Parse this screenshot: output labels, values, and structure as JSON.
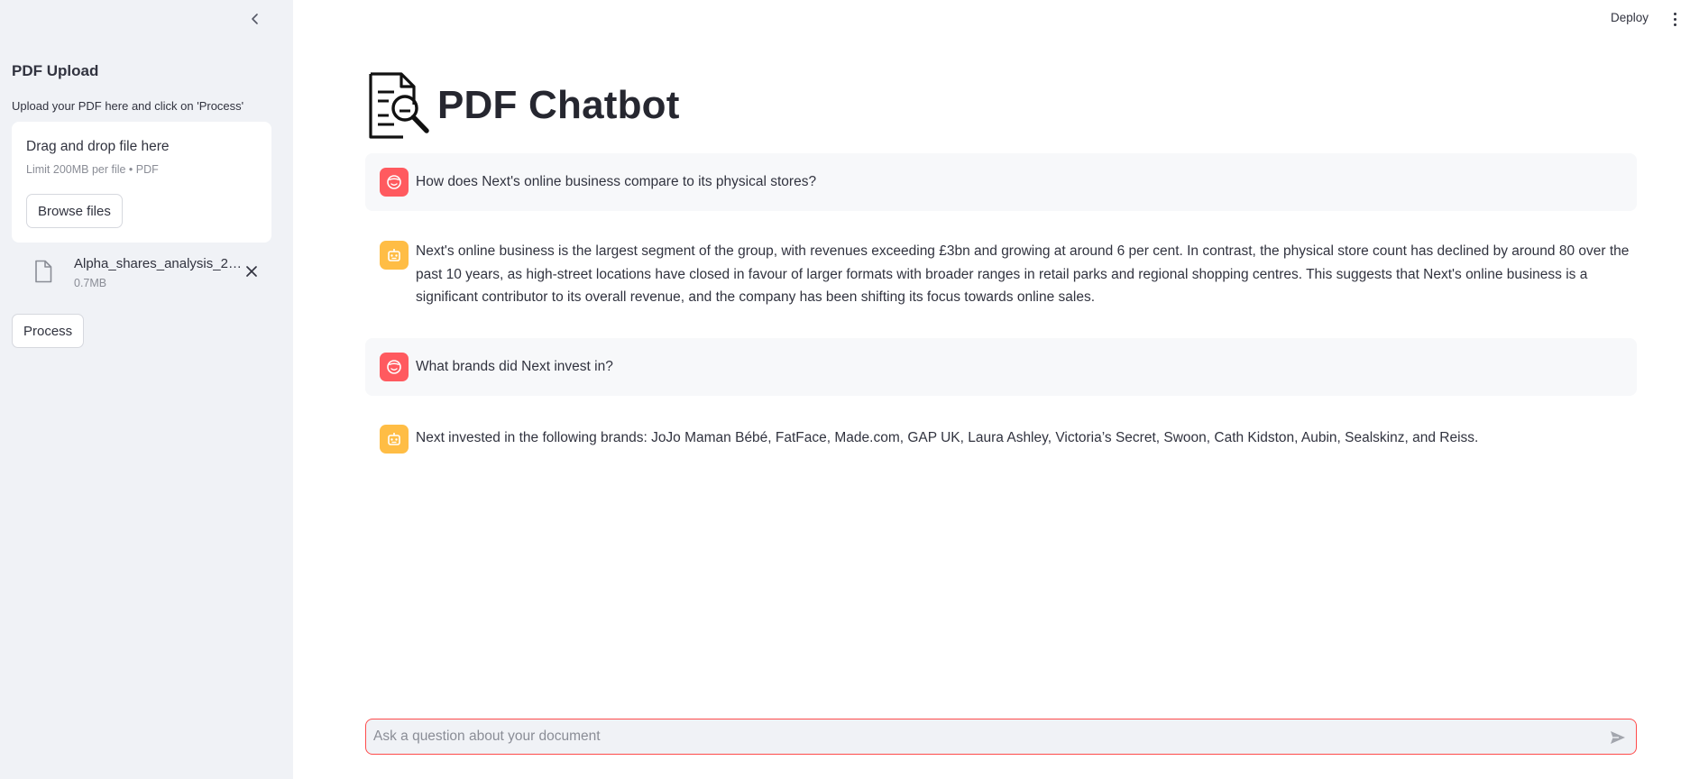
{
  "sidebar": {
    "title": "PDF Upload",
    "description": "Upload your PDF here and click on 'Process'",
    "dropzone": {
      "title": "Drag and drop file here",
      "limit": "Limit 200MB per file • PDF",
      "browse_label": "Browse files"
    },
    "file": {
      "name": "Alpha_shares_analysis_2…",
      "size": "0.7MB"
    },
    "process_label": "Process"
  },
  "header": {
    "deploy_label": "Deploy"
  },
  "main": {
    "title": "PDF Chatbot",
    "messages": [
      {
        "role": "user",
        "text": "How does Next's online business compare to its physical stores?"
      },
      {
        "role": "assistant",
        "text": "Next's online business is the largest segment of the group, with revenues exceeding £3bn and growing at around 6 per cent. In contrast, the physical store count has declined by around 80 over the past 10 years, as high-street locations have closed in favour of larger formats with broader ranges in retail parks and regional shopping centres. This suggests that Next's online business is a significant contributor to its overall revenue, and the company has been shifting its focus towards online sales."
      },
      {
        "role": "user",
        "text": "What brands did Next invest in?"
      },
      {
        "role": "assistant",
        "text": "Next invested in the following brands: JoJo Maman Bébé, FatFace, Made.com, GAP UK, Laura Ashley, Victoria’s Secret, Swoon, Cath Kidston, Aubin, Sealskinz, and Reiss."
      }
    ]
  },
  "chat_input": {
    "placeholder": "Ask a question about your document",
    "value": ""
  },
  "colors": {
    "sidebar_bg": "#f0f2f6",
    "user_avatar": "#ff5a5f",
    "bot_avatar": "#ffbd45",
    "input_border": "#ff4b4b",
    "user_message_bg": "#f7f8fa"
  },
  "icons": {
    "collapse": "chevron-left-icon",
    "file": "file-icon",
    "remove": "close-icon",
    "logo": "document-search-icon",
    "user_avatar": "user-face-icon",
    "bot_avatar": "robot-icon",
    "send": "send-icon",
    "menu": "more-vertical-icon"
  }
}
